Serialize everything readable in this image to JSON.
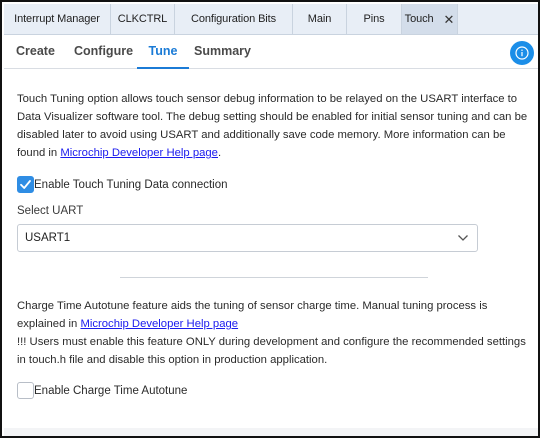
{
  "tabs": [
    {
      "label": "Interrupt Manager"
    },
    {
      "label": "CLKCTRL"
    },
    {
      "label": "Configuration Bits"
    },
    {
      "label": "Main"
    },
    {
      "label": "Pins"
    },
    {
      "label": "Touch",
      "active": true,
      "close": "✕"
    }
  ],
  "subtabs": [
    {
      "label": "Create"
    },
    {
      "label": "Configure"
    },
    {
      "label": "Tune",
      "active": true
    },
    {
      "label": "Summary"
    }
  ],
  "tuning": {
    "description": "Touch Tuning option allows touch sensor debug information to be relayed on the USART interface to Data Visualizer software tool. The debug setting should be enabled for initial sensor tuning and can be disabled later to avoid using USART and additionally save code memory. More information can be found in ",
    "link": "Microchip Developer Help page",
    "description_end": ".",
    "enable_label": "Enable Touch Tuning Data connection",
    "enable_checked": true,
    "select_uart_label": "Select UART",
    "uart_value": "USART1"
  },
  "autotune": {
    "description": "Charge Time Autotune feature aids the tuning of sensor charge time. Manual tuning process is explained in ",
    "link": "Microchip Developer Help page",
    "warning": "!!! Users must enable this feature ONLY during development and configure the recommended settings in touch.h file and disable this option in production application.",
    "enable_label": "Enable Charge Time Autotune",
    "enable_checked": false
  },
  "colors": {
    "accent": "#1b7bd6",
    "info_button": "#1b8ee8",
    "checkbox_checked": "#2f8de4",
    "link": "#1a1aee"
  }
}
